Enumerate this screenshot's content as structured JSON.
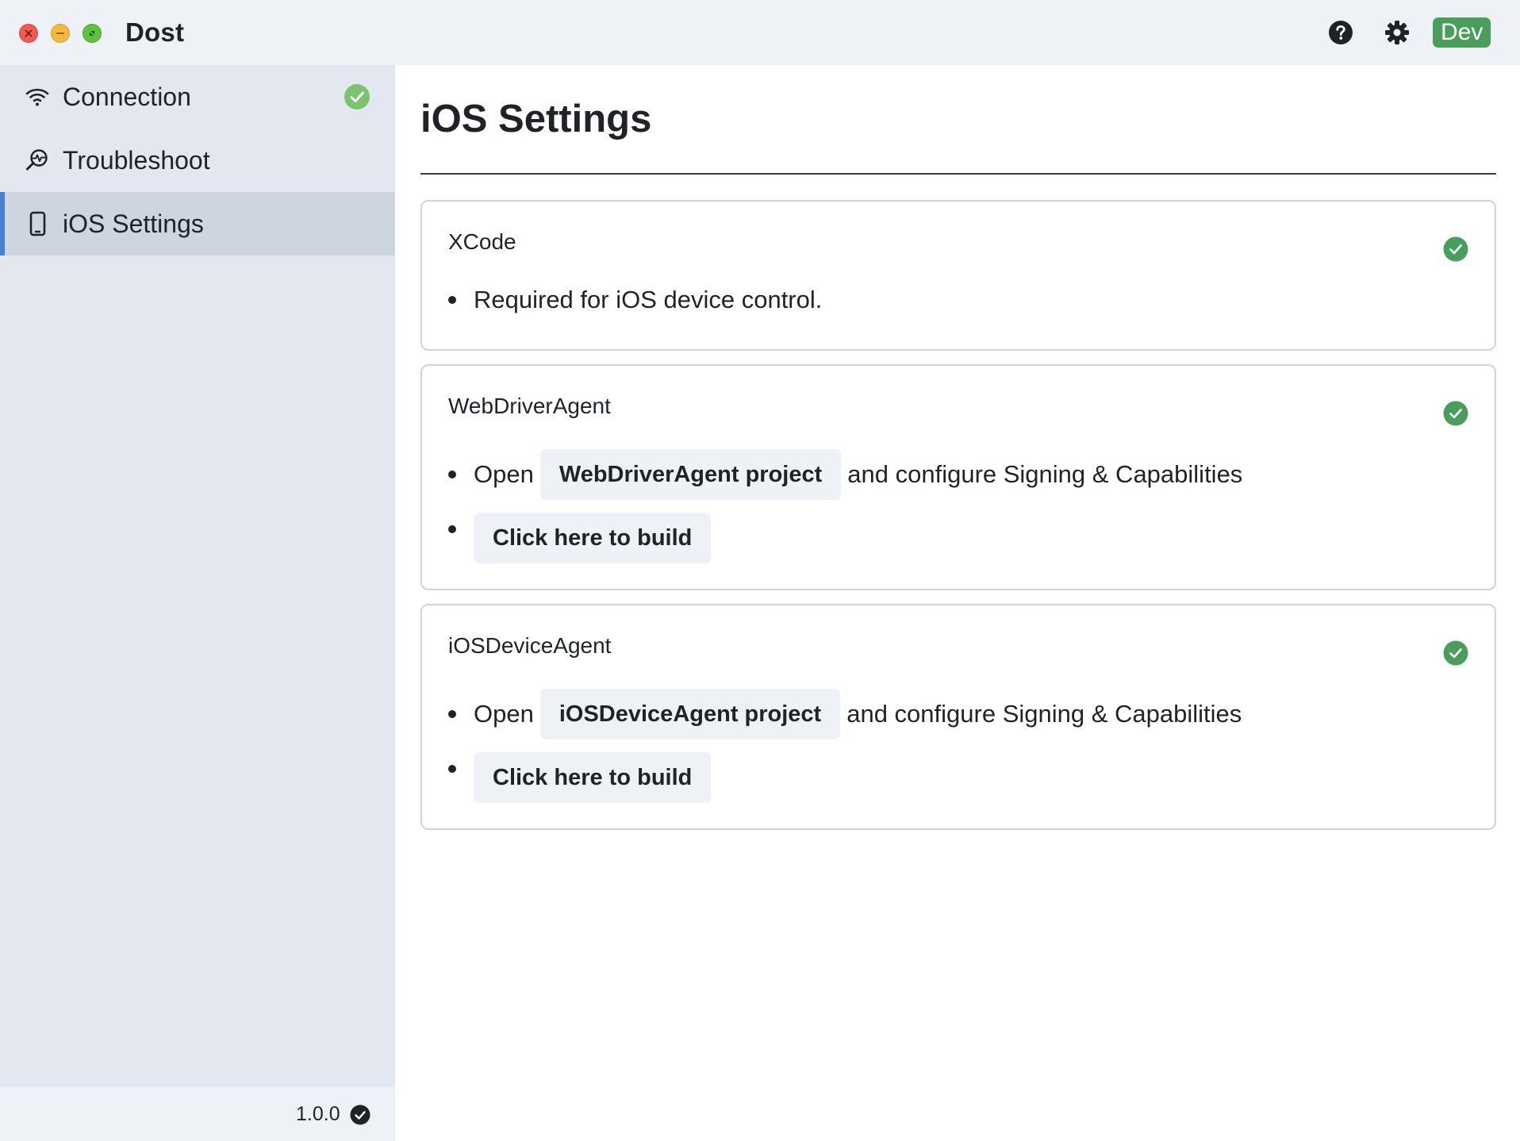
{
  "window": {
    "app_title": "Dost",
    "badge": "Dev",
    "traffic_lights": [
      "close",
      "minimize",
      "maximize"
    ]
  },
  "colors": {
    "accent": "#4a7fd0",
    "success": "#4a9e5c",
    "sidebar_bg": "#e3e8f0",
    "sidebar_active": "#cdd5e0",
    "button_bg": "#eef1f5"
  },
  "sidebar": {
    "items": [
      {
        "label": "Connection",
        "icon": "wifi-icon",
        "status": "ok"
      },
      {
        "label": "Troubleshoot",
        "icon": "troubleshoot-icon"
      },
      {
        "label": "iOS Settings",
        "icon": "phone-icon",
        "active": true
      }
    ],
    "footer": {
      "version": "1.0.0"
    }
  },
  "main": {
    "title": "iOS Settings",
    "cards": [
      {
        "title": "XCode",
        "status": "ok",
        "bullets": [
          {
            "text": "Required for iOS device control."
          }
        ]
      },
      {
        "title": "WebDriverAgent",
        "status": "ok",
        "open_prefix": "Open",
        "project_button": "WebDriverAgent project",
        "open_suffix": "and configure Signing & Capabilities",
        "build_button": "Click here to build"
      },
      {
        "title": "iOSDeviceAgent",
        "status": "ok",
        "open_prefix": "Open",
        "project_button": "iOSDeviceAgent project",
        "open_suffix": "and configure Signing & Capabilities",
        "build_button": "Click here to build"
      }
    ]
  }
}
